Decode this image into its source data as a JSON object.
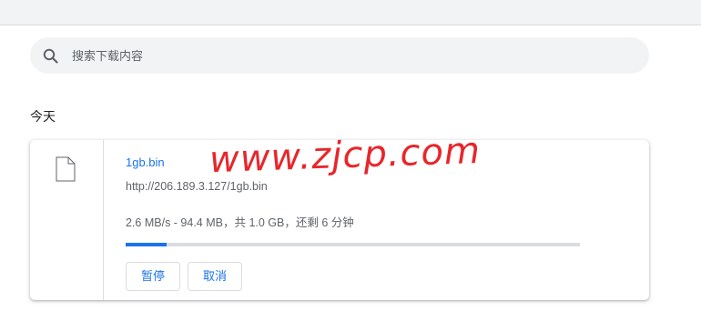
{
  "search": {
    "placeholder": "搜索下载内容",
    "value": ""
  },
  "section": {
    "title": "今天"
  },
  "download": {
    "file_name": "1gb.bin",
    "url": "http://206.189.3.127/1gb.bin",
    "status": "2.6 MB/s - 94.4 MB，共 1.0 GB，还剩 6 分钟",
    "progress": 0.09,
    "pause_label": "暂停",
    "cancel_label": "取消"
  },
  "watermark": {
    "text": "www.zjcp.com"
  },
  "colors": {
    "accent": "#1a73e8",
    "watermark": "#e8262b"
  }
}
